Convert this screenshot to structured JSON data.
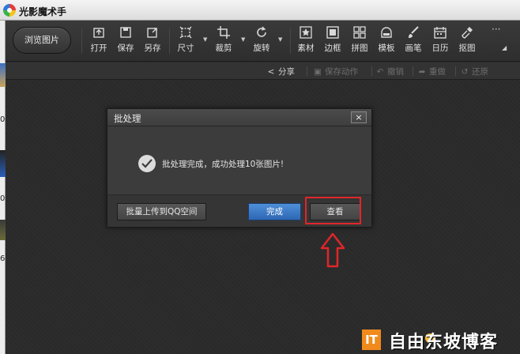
{
  "app": {
    "title": "光影魔术手"
  },
  "toolbar": {
    "browse_label": "浏览图片",
    "tools": [
      {
        "label": "打开",
        "icon": "open-icon"
      },
      {
        "label": "保存",
        "icon": "save-icon"
      },
      {
        "label": "另存",
        "icon": "save-as-icon"
      },
      {
        "label": "尺寸",
        "icon": "resize-icon"
      },
      {
        "label": "裁剪",
        "icon": "crop-icon"
      },
      {
        "label": "旋转",
        "icon": "rotate-icon"
      },
      {
        "label": "素材",
        "icon": "material-icon"
      },
      {
        "label": "边框",
        "icon": "border-icon"
      },
      {
        "label": "拼图",
        "icon": "collage-icon"
      },
      {
        "label": "模板",
        "icon": "template-icon"
      },
      {
        "label": "画笔",
        "icon": "brush-icon"
      },
      {
        "label": "日历",
        "icon": "calendar-icon"
      },
      {
        "label": "抠图",
        "icon": "cutout-icon"
      }
    ],
    "more_label": "···"
  },
  "actionbar": {
    "share": "分享",
    "save_action": "保存动作",
    "undo": "撤销",
    "redo": "重做",
    "restore": "还原"
  },
  "dialog": {
    "title": "批处理",
    "close": "×",
    "message": "批处理完成，成功处理10张图片!",
    "upload_button": "批量上传到QQ空间",
    "done_button": "完成",
    "view_button": "查看"
  },
  "left_strip": {
    "chars": [
      "0",
      "0",
      "6"
    ]
  },
  "watermark": {
    "badge": "IT",
    "text": "自由东坡博客"
  },
  "colors": {
    "highlight": "#e0262a",
    "done_button": "#2d67b4",
    "watermark_badge": "#f08a1c"
  }
}
